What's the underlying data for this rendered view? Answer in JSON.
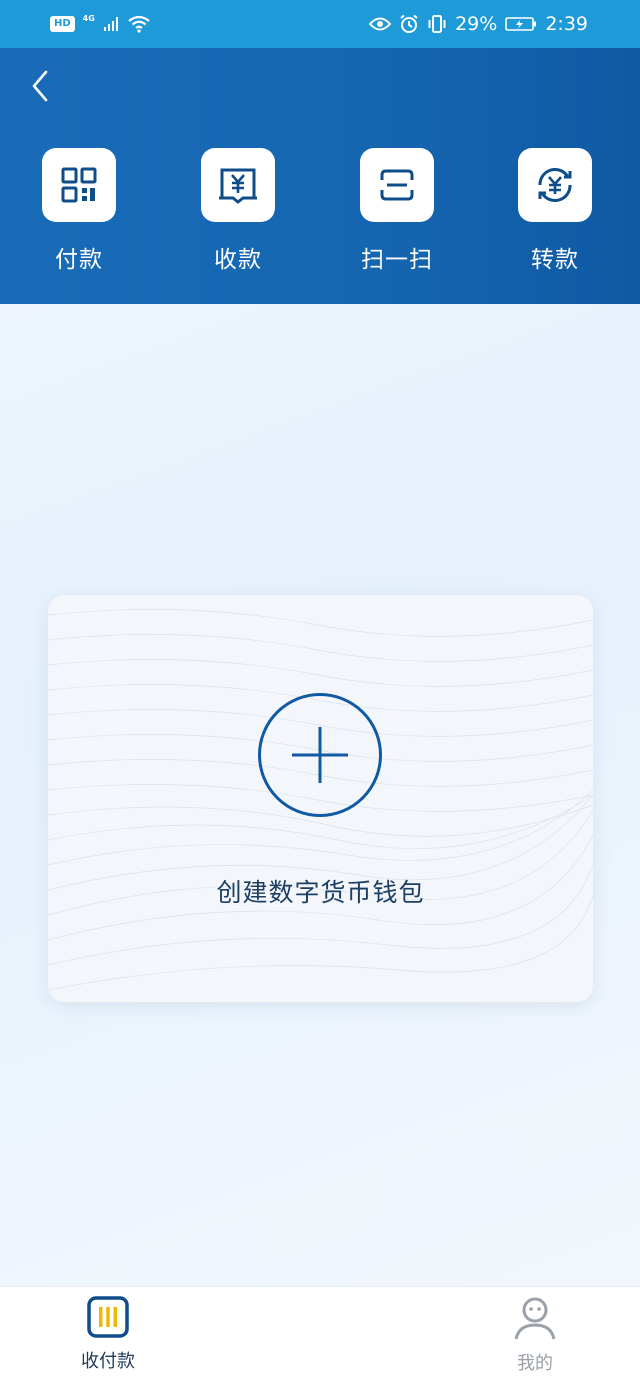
{
  "status_bar": {
    "hd": "HD",
    "network": "4G",
    "battery": "29%",
    "time": "2:39"
  },
  "header": {
    "actions": [
      {
        "label": "付款",
        "icon": "qr-code-icon"
      },
      {
        "label": "收款",
        "icon": "receive-yuan-icon"
      },
      {
        "label": "扫一扫",
        "icon": "scan-icon"
      },
      {
        "label": "转款",
        "icon": "transfer-yuan-icon"
      }
    ]
  },
  "wallet_card": {
    "label": "创建数字货币钱包",
    "icon": "plus-icon"
  },
  "bottom_nav": {
    "items": [
      {
        "label": "收付款",
        "icon": "wallet-icon",
        "active": true
      },
      {
        "label": "我的",
        "icon": "profile-icon",
        "active": false
      }
    ]
  },
  "colors": {
    "status_bar": "#1f9ad8",
    "header": "#1565b0",
    "accent": "#0f5aa3",
    "nav_active_icon": "#f2b705"
  }
}
